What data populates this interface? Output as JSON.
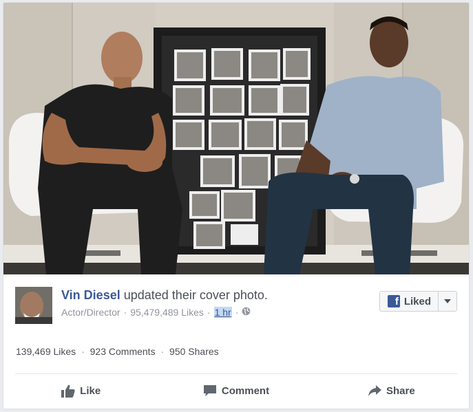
{
  "post": {
    "author": "Vin Diesel",
    "action_text": "updated their cover photo.",
    "category": "Actor/Director",
    "page_likes": "95,479,489 Likes",
    "time": "1 hr",
    "privacy_icon": "globe-icon",
    "separator": "·"
  },
  "liked_button": {
    "label": "Liked",
    "icon": "facebook-f-icon",
    "dropdown_icon": "caret-down-icon"
  },
  "stats": {
    "likes": "139,469 Likes",
    "comments": "923 Comments",
    "shares": "950 Shares"
  },
  "actions": [
    {
      "label": "Like",
      "icon": "thumbs-up-icon"
    },
    {
      "label": "Comment",
      "icon": "comment-bubble-icon"
    },
    {
      "label": "Share",
      "icon": "share-arrow-icon"
    }
  ],
  "colors": {
    "link_blue": "#3b5998",
    "text": "#4b4f56",
    "secondary_text": "#90949c",
    "time_highlight": "#c3d9f1"
  }
}
